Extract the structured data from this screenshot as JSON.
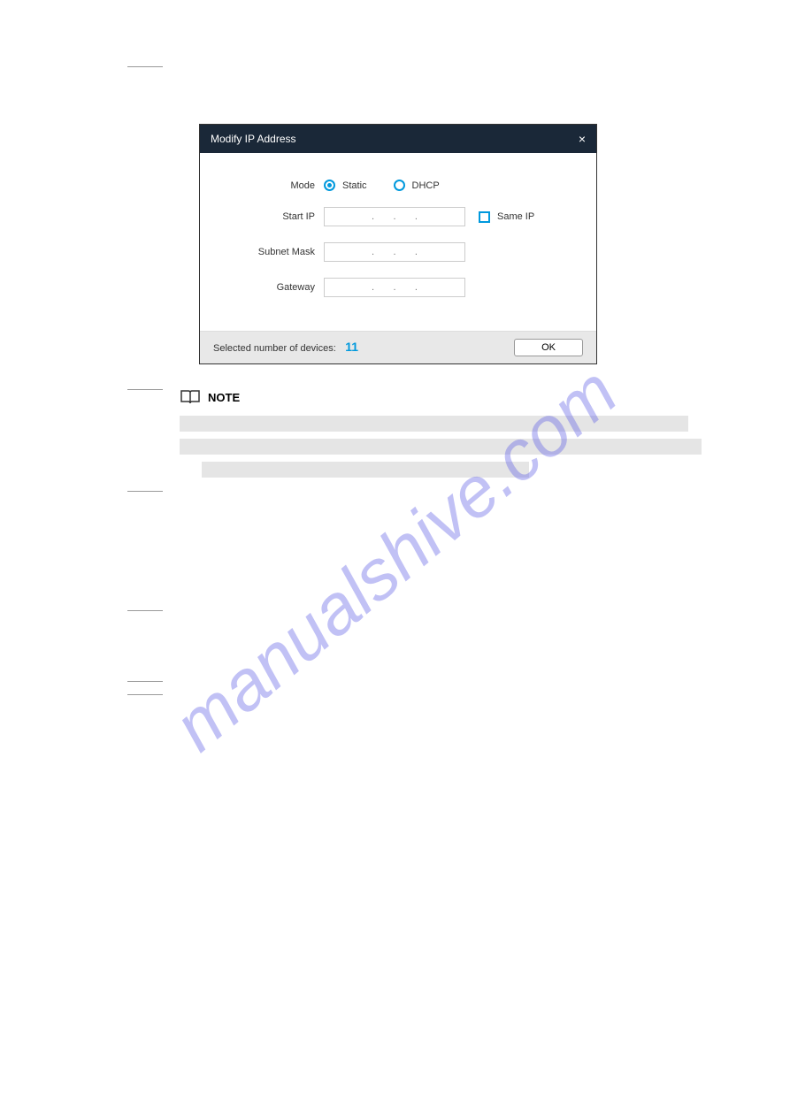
{
  "dialog": {
    "title": "Modify IP Address",
    "close_label": "×",
    "fields": {
      "mode_label": "Mode",
      "static_label": "Static",
      "dhcp_label": "DHCP",
      "start_ip_label": "Start IP",
      "same_ip_label": "Same IP",
      "subnet_mask_label": "Subnet Mask",
      "gateway_label": "Gateway",
      "ip_placeholder": ".       .       ."
    },
    "footer": {
      "device_count_label": "Selected number of devices:",
      "device_count": "11",
      "ok_label": "OK"
    }
  },
  "note": {
    "label": "NOTE"
  },
  "watermark": "manualshive.com"
}
